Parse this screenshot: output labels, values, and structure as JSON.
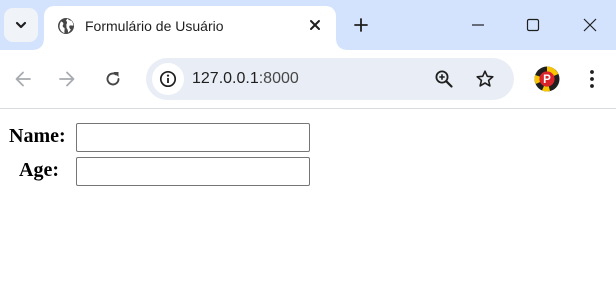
{
  "browser": {
    "tab": {
      "title": "Formulário de Usuário",
      "favicon": "globe-icon"
    },
    "address_bar": {
      "host": "127.0.0.1",
      "port": ":8000"
    },
    "profile_badge": "P",
    "icons": {
      "tab_search": "chevron-down-icon",
      "tab_close": "close-icon",
      "new_tab": "plus-icon",
      "minimize": "minimize-icon",
      "maximize": "maximize-icon",
      "window_close": "close-icon",
      "back": "arrow-left-icon",
      "forward": "arrow-right-icon",
      "reload": "reload-icon",
      "site_info": "site-info-icon",
      "zoom": "zoom-in-icon",
      "bookmark": "star-icon",
      "menu": "kebab-menu-icon"
    },
    "colors": {
      "tabstrip": "#d3e3fd",
      "omnibox": "#e9eef6",
      "profile_red": "#d9242b",
      "profile_yellow": "#f7c600"
    }
  },
  "form": {
    "name_label": "Name:",
    "name_value": "",
    "age_label": "Age:",
    "age_value": ""
  }
}
